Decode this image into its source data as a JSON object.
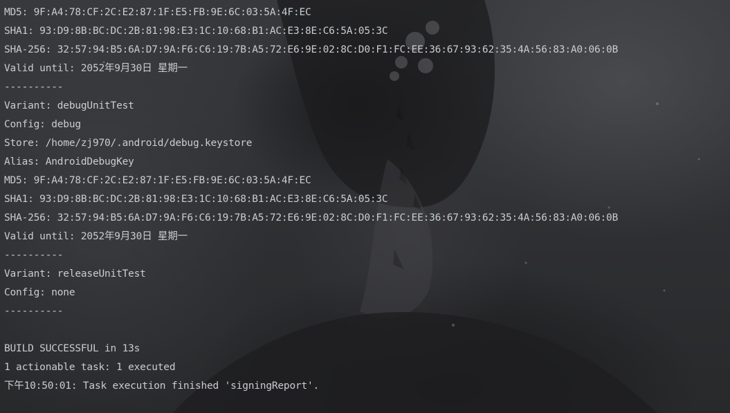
{
  "console": {
    "lines": [
      "MD5: 9F:A4:78:CF:2C:E2:87:1F:E5:FB:9E:6C:03:5A:4F:EC",
      "SHA1: 93:D9:8B:BC:DC:2B:81:98:E3:1C:10:68:B1:AC:E3:8E:C6:5A:05:3C",
      "SHA-256: 32:57:94:B5:6A:D7:9A:F6:C6:19:7B:A5:72:E6:9E:02:8C:D0:F1:FC:EE:36:67:93:62:35:4A:56:83:A0:06:0B",
      "Valid until: 2052年9月30日 星期一",
      "----------",
      "Variant: debugUnitTest",
      "Config: debug",
      "Store: /home/zj970/.android/debug.keystore",
      "Alias: AndroidDebugKey",
      "MD5: 9F:A4:78:CF:2C:E2:87:1F:E5:FB:9E:6C:03:5A:4F:EC",
      "SHA1: 93:D9:8B:BC:DC:2B:81:98:E3:1C:10:68:B1:AC:E3:8E:C6:5A:05:3C",
      "SHA-256: 32:57:94:B5:6A:D7:9A:F6:C6:19:7B:A5:72:E6:9E:02:8C:D0:F1:FC:EE:36:67:93:62:35:4A:56:83:A0:06:0B",
      "Valid until: 2052年9月30日 星期一",
      "----------",
      "Variant: releaseUnitTest",
      "Config: none",
      "----------",
      "",
      "BUILD SUCCESSFUL in 13s",
      "1 actionable task: 1 executed",
      "下午10:50:01: Task execution finished 'signingReport'."
    ]
  },
  "colors": {
    "text": "#c9ccd1",
    "background": "#2b2d30"
  }
}
